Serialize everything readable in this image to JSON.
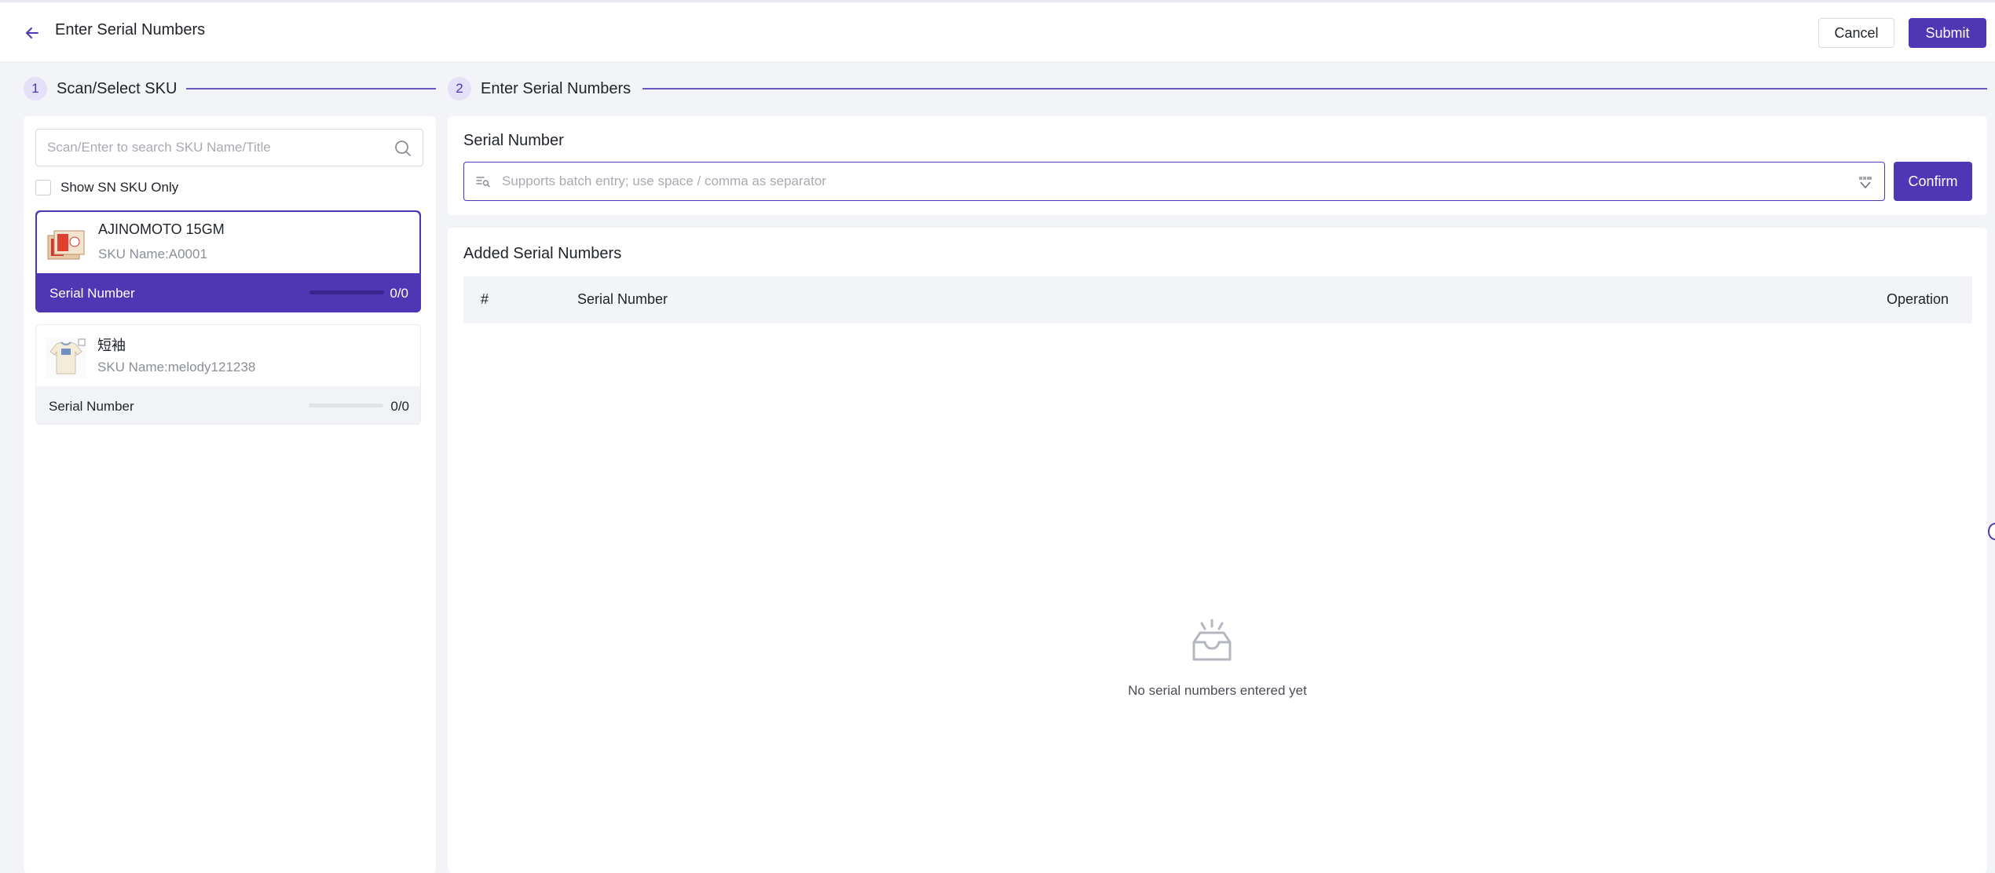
{
  "header": {
    "title": "Enter Serial Numbers",
    "cancel_label": "Cancel",
    "submit_label": "Submit"
  },
  "steps": [
    {
      "number": "1",
      "label": "Scan/Select SKU"
    },
    {
      "number": "2",
      "label": "Enter Serial Numbers"
    }
  ],
  "sku_panel": {
    "search_placeholder": "Scan/Enter to search SKU Name/Title",
    "show_sn_only_label": "Show SN SKU Only",
    "show_sn_only_checked": false,
    "items": [
      {
        "title": "AJINOMOTO 15GM",
        "sku_name": "SKU Name:A0001",
        "sn_label": "Serial Number",
        "sn_count": "0/0",
        "selected": true,
        "thumb": "product-box-thumbnail"
      },
      {
        "title": "短袖",
        "sku_name": "SKU Name:melody121238",
        "sn_label": "Serial Number",
        "sn_count": "0/0",
        "selected": false,
        "thumb": "shirt-thumbnail"
      }
    ]
  },
  "serial_input": {
    "section_title": "Serial Number",
    "placeholder": "Supports batch entry; use space / comma as separator",
    "value": "",
    "confirm_label": "Confirm"
  },
  "added": {
    "section_title": "Added Serial Numbers",
    "columns": [
      "#",
      "Serial Number",
      "Operation"
    ],
    "rows": [],
    "empty_text": "No serial numbers entered yet"
  },
  "colors": {
    "primary": "#4e36b5",
    "step_badge_bg": "#e4e0f7",
    "page_bg": "#f3f4f7"
  }
}
